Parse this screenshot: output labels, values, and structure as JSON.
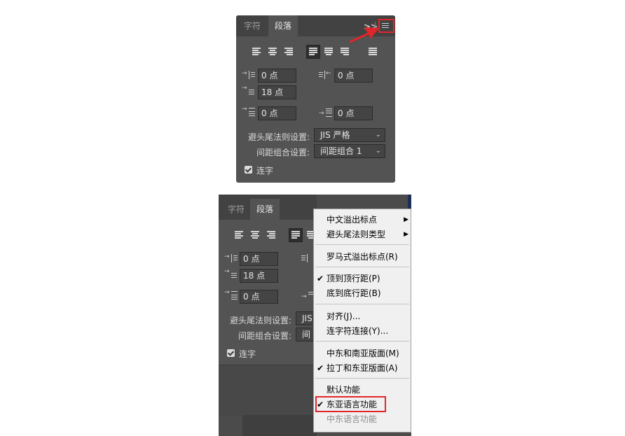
{
  "panel_top": {
    "tabs": [
      {
        "label": "字符"
      },
      {
        "label": "段落"
      }
    ],
    "collapse_label": ">>",
    "fields": {
      "left_indent": "0 点",
      "right_indent": "0 点",
      "first_line_indent": "18 点",
      "space_before": "0 点",
      "space_after": "0 点"
    },
    "kinsoku_label": "避头尾法则设置:",
    "kinsoku_value": "JIS 严格",
    "mojikumi_label": "间距组合设置:",
    "mojikumi_value": "间距组合 1",
    "hyphenate_label": "连字"
  },
  "panel_bottom": {
    "tabs": [
      {
        "label": "字符"
      },
      {
        "label": "段落"
      }
    ],
    "fields": {
      "left_indent": "0 点",
      "first_line_indent": "18 点",
      "space_before": "0 点"
    },
    "kinsoku_label": "避头尾法则设置:",
    "kinsoku_value": "JIS",
    "mojikumi_label": "间距组合设置:",
    "mojikumi_value": "间",
    "hyphenate_label": "连字"
  },
  "flyout_menu": {
    "items": [
      {
        "label": "中文溢出标点",
        "checked": false,
        "submenu": true,
        "disabled": false
      },
      {
        "label": "避头尾法则类型",
        "checked": false,
        "submenu": true,
        "disabled": false
      },
      {
        "label": "罗马式溢出标点(R)",
        "checked": false,
        "submenu": false,
        "disabled": false
      },
      {
        "label": "顶到顶行距(P)",
        "checked": true,
        "submenu": false,
        "disabled": false
      },
      {
        "label": "底到底行距(B)",
        "checked": false,
        "submenu": false,
        "disabled": false
      },
      {
        "label": "对齐(J)...",
        "checked": false,
        "submenu": false,
        "disabled": false
      },
      {
        "label": "连字符连接(Y)...",
        "checked": false,
        "submenu": false,
        "disabled": false
      },
      {
        "label": "中东和南亚版面(M)",
        "checked": false,
        "submenu": false,
        "disabled": false
      },
      {
        "label": "拉丁和东亚版面(A)",
        "checked": true,
        "submenu": false,
        "disabled": false
      },
      {
        "label": "默认功能",
        "checked": false,
        "submenu": false,
        "disabled": false
      },
      {
        "label": "东亚语言功能",
        "checked": true,
        "submenu": false,
        "disabled": false
      },
      {
        "label": "中东语言功能",
        "checked": false,
        "submenu": false,
        "disabled": true
      }
    ]
  },
  "colors": {
    "panel_bg": "#535353",
    "tabbar_bg": "#424242",
    "highlight": "#e0262b",
    "menu_bg": "#f0f0f0"
  }
}
